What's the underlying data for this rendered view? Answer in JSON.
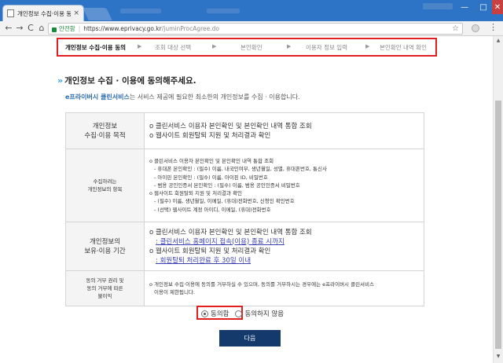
{
  "browser": {
    "tab_title": "개인정보 수집·이용 동의",
    "tab_close": "×",
    "secure_label": "안전함",
    "url_host": "https://www.eprivacy.go.kr",
    "url_path": "/juminProcAgree.do",
    "back": "←",
    "forward": "→",
    "reload": "C",
    "home": "⌂",
    "bookmark_star": "☆",
    "menu": "⋮",
    "min": "—",
    "max": "□",
    "close": "✕"
  },
  "steps": [
    {
      "label": "개인정보 수집·이용 동의",
      "active": true
    },
    {
      "label": "조회 대상 선택",
      "active": false
    },
    {
      "label": "본인확인",
      "active": false
    },
    {
      "label": "이용자 정보 입력",
      "active": false
    },
    {
      "label": "본인확인 내역 확인",
      "active": false
    }
  ],
  "step_arrow": "▶",
  "page": {
    "heading_chevron": "»",
    "heading": "개인정보 수집 · 이용에 동의해주세요.",
    "intro_brand": "e프라이버시 클린서비스",
    "intro_rest": "는 서비스 제공에 필요한 최소한의 개인정보를 수집 · 이용합니다."
  },
  "table": {
    "purpose_label_1": "개인정보",
    "purpose_label_2": "수집·이용 목적",
    "purpose_lines": [
      "o 클린서비스 이용자 본인확인 및 본인확인 내역 통합 조회",
      "o 웹사이트 회원탈퇴 지원 및 처리결과 확인"
    ],
    "items_label_1": "수집하려는",
    "items_label_2": "개인정보의 항목",
    "items_lines": [
      {
        "text": "o 클린서비스 이용자 본인확인 및 본인확인 내역 통합 조회",
        "indent": false
      },
      {
        "text": "- 휴대폰 본인확인 : (필수) 이름, 내국인여부, 생년월일, 성별, 휴대폰번호, 통신사",
        "indent": true
      },
      {
        "text": "- 아이핀 본인확인 : (필수) 이름, 아이핀 ID, 비밀번호",
        "indent": true
      },
      {
        "text": "- 범용 공인인증서 본인확인 : (필수) 이름, 범용 공인인증서 비밀번호",
        "indent": true
      },
      {
        "text": "o 웹사이트 회원탈퇴 지원 및 처리결과 확인",
        "indent": false
      },
      {
        "text": "- (필수) 이름, 생년월일, 이메일, (휴대)전화번호, 신청인 확인번호",
        "indent": true
      },
      {
        "text": "- (선택) 웹사이트 계정 아이디, 이메일, (휴대)전화번호",
        "indent": true
      }
    ],
    "retention_label_1": "개인정보의",
    "retention_label_2": "보유·이용 기간",
    "retention_lines": [
      {
        "text": "o 클린서비스 이용자 본인확인 및 본인확인 내역 통합 조회",
        "link": false
      },
      {
        "text": ": 클린서비스 홈페이지 접속(이용) 종료 시까지",
        "link": true
      },
      {
        "text": "o 웹사이트 회원탈퇴 지원 및 처리결과 확인",
        "link": false
      },
      {
        "text": ": 회원탈퇴 처리완료 후 30일 이내",
        "link": true
      }
    ],
    "refusal_label_1": "동의 거부 권리 및",
    "refusal_label_2": "동의 거부에 따른",
    "refusal_label_3": "불이익",
    "refusal_text_1": "o 개인정보 수집·이용에 동의를 거부하실 수 있으며, 동의를 거부하시는 경우에는 e프라이버시 클린서비스",
    "refusal_text_2": "이용이 제한됩니다."
  },
  "consent": {
    "agree": "동의함",
    "disagree": "동의하지 않음",
    "selected": "agree"
  },
  "next_button": "다음"
}
